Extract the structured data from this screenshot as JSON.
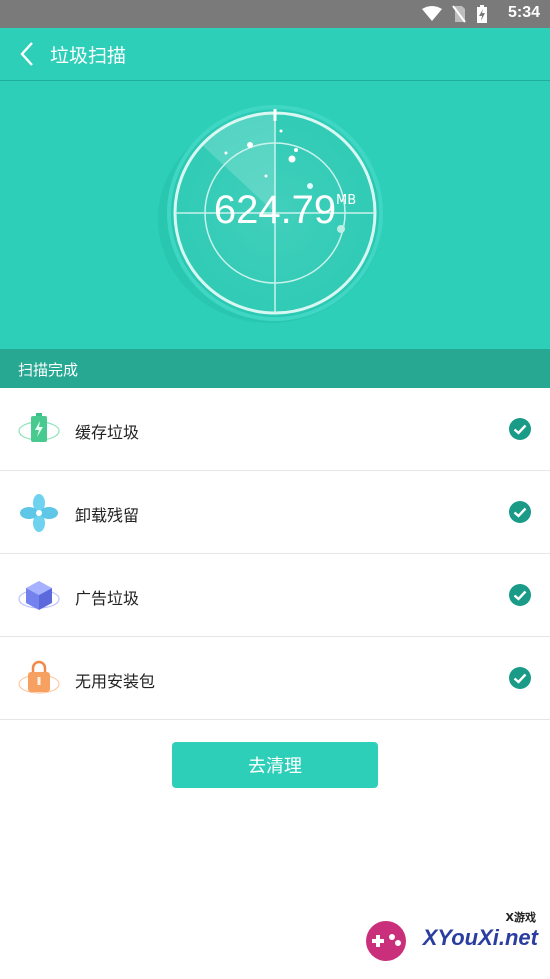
{
  "status_bar": {
    "time": "5:34",
    "icons": [
      "wifi-icon",
      "no-sim-icon",
      "battery-icon"
    ]
  },
  "header": {
    "title": "垃圾扫描",
    "back_icon": "chevron-left-icon"
  },
  "scan": {
    "value": "624.79",
    "unit": "MB"
  },
  "section": {
    "label": "扫描完成"
  },
  "items": [
    {
      "label": "缓存垃圾",
      "icon": "battery-cache-icon",
      "checked": true
    },
    {
      "label": "卸载残留",
      "icon": "fan-icon",
      "checked": true
    },
    {
      "label": "广告垃圾",
      "icon": "cube-icon",
      "checked": true
    },
    {
      "label": "无用安装包",
      "icon": "package-lock-icon",
      "checked": true
    }
  ],
  "action": {
    "clean_label": "去清理"
  },
  "watermark": {
    "tag": "X游戏",
    "brand": "XYouXi.net"
  },
  "colors": {
    "primary": "#2ecfb9",
    "section": "#26a893",
    "check": "#1a9b87"
  }
}
